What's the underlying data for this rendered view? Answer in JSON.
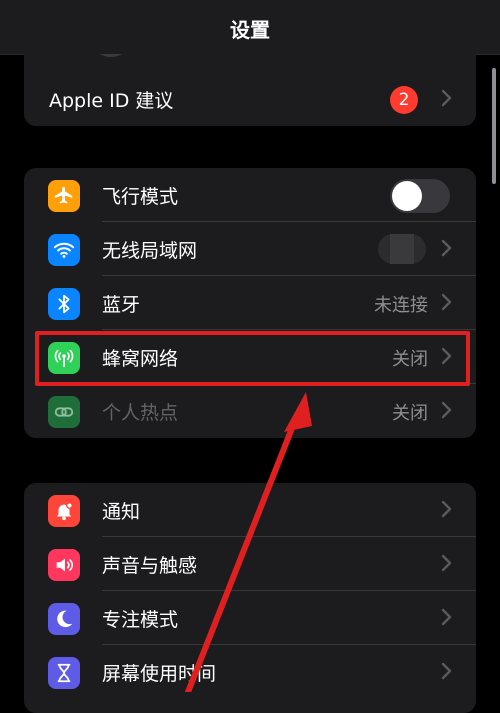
{
  "header": {
    "title": "设置"
  },
  "apple_id": {
    "label": "Apple ID 建议",
    "badge": "2"
  },
  "network": {
    "airplane": {
      "label": "飞行模式",
      "icon": "airplane-icon",
      "color": "#ff9f0a"
    },
    "wifi": {
      "label": "无线局域网",
      "icon": "wifi-icon",
      "color": "#0a84ff"
    },
    "bluetooth": {
      "label": "蓝牙",
      "value": "未连接",
      "icon": "bluetooth-icon",
      "color": "#0a84ff"
    },
    "cellular": {
      "label": "蜂窝网络",
      "value": "关闭",
      "icon": "antenna-icon",
      "color": "#30d158"
    },
    "hotspot": {
      "label": "个人热点",
      "value": "关闭",
      "icon": "chain-link-icon",
      "color": "#1f6e3a"
    }
  },
  "notifications": {
    "notify": {
      "label": "通知",
      "icon": "bell-icon",
      "color": "#ff453a"
    },
    "sounds": {
      "label": "声音与触感",
      "icon": "speaker-icon",
      "color": "#ff375f"
    },
    "focus": {
      "label": "专注模式",
      "icon": "moon-icon",
      "color": "#5e5ce6"
    },
    "screentime": {
      "label": "屏幕使用时间",
      "icon": "hourglass-icon",
      "color": "#5e5ce6"
    }
  },
  "annotation_color": "#e02020"
}
